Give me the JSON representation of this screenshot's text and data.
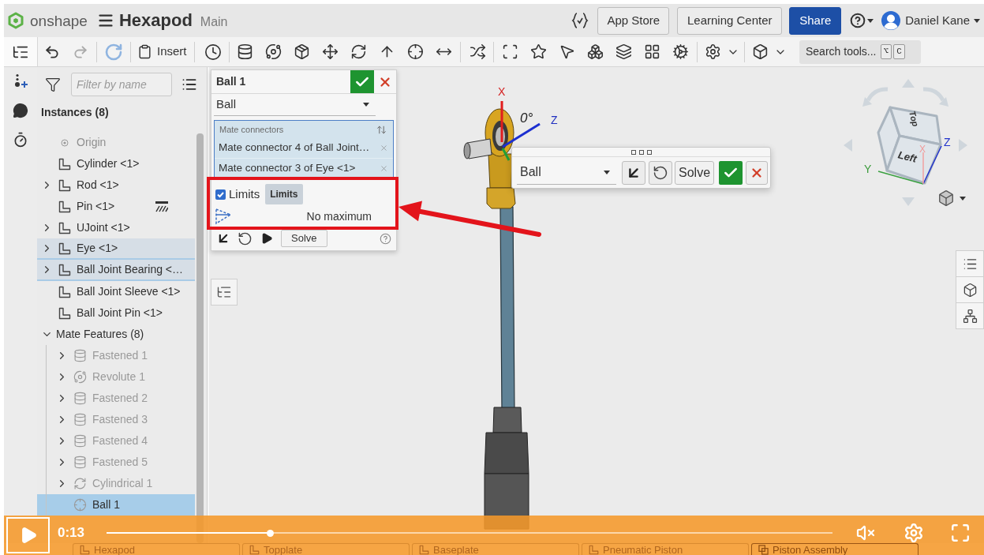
{
  "header": {
    "logo": "onshape",
    "document": "Hexapod",
    "workspace": "Main",
    "buttons": [
      {
        "label": "App Store",
        "kind": "default"
      },
      {
        "label": "Learning Center",
        "kind": "default"
      },
      {
        "label": "Share",
        "kind": "primary"
      }
    ],
    "user": "Daniel Kane"
  },
  "toolbar": {
    "undo": {
      "disabled": false
    },
    "redo": {
      "disabled": true
    },
    "insert": "Insert",
    "search": {
      "placeholder": "Search tools...",
      "keys": [
        "⌥",
        "C"
      ]
    }
  },
  "instances": {
    "filter": {
      "placeholder": "Filter by name"
    },
    "title": "Instances (8)",
    "items": [
      {
        "label": "Origin",
        "kind": "origin",
        "expandable": false,
        "highlighted": false,
        "dimmed": true,
        "has_marker": false
      },
      {
        "label": "Cylinder <1>",
        "kind": "part",
        "expandable": false,
        "highlighted": false,
        "dimmed": false,
        "has_marker": false
      },
      {
        "label": "Rod <1>",
        "kind": "part",
        "expandable": true,
        "highlighted": false,
        "dimmed": false,
        "has_marker": false
      },
      {
        "label": "Pin <1>",
        "kind": "part",
        "expandable": false,
        "highlighted": false,
        "dimmed": false,
        "has_marker": true
      },
      {
        "label": "UJoint <1>",
        "kind": "part",
        "expandable": true,
        "highlighted": false,
        "dimmed": false,
        "has_marker": false
      },
      {
        "label": "Eye <1>",
        "kind": "part",
        "expandable": true,
        "highlighted": true,
        "dimmed": false,
        "has_marker": false
      },
      {
        "label": "Ball Joint Bearing <…",
        "kind": "part",
        "expandable": true,
        "highlighted": true,
        "dimmed": false,
        "has_marker": false
      },
      {
        "label": "Ball Joint Sleeve <1>",
        "kind": "part",
        "expandable": false,
        "highlighted": false,
        "dimmed": false,
        "has_marker": false
      },
      {
        "label": "Ball Joint Pin <1>",
        "kind": "part",
        "expandable": false,
        "highlighted": false,
        "dimmed": false,
        "has_marker": false
      }
    ]
  },
  "mate_features": {
    "title": "Mate Features (8)",
    "expanded": true,
    "children": [
      {
        "label": "Fastened 1",
        "kind": "fastened",
        "expandable": true,
        "selected": false,
        "dimmed": true
      },
      {
        "label": "Revolute 1",
        "kind": "revolute",
        "expandable": true,
        "selected": false,
        "dimmed": true
      },
      {
        "label": "Fastened 2",
        "kind": "fastened",
        "expandable": true,
        "selected": false,
        "dimmed": true
      },
      {
        "label": "Fastened 3",
        "kind": "fastened",
        "expandable": true,
        "selected": false,
        "dimmed": true
      },
      {
        "label": "Fastened 4",
        "kind": "fastened",
        "expandable": true,
        "selected": false,
        "dimmed": true
      },
      {
        "label": "Fastened 5",
        "kind": "fastened",
        "expandable": true,
        "selected": false,
        "dimmed": true
      },
      {
        "label": "Cylindrical 1",
        "kind": "cylindrical",
        "expandable": true,
        "selected": false,
        "dimmed": true
      },
      {
        "label": "Ball 1",
        "kind": "ball",
        "expandable": false,
        "selected": true,
        "dimmed": false
      }
    ]
  },
  "mate_dialog": {
    "title": "Ball 1",
    "type": "Ball",
    "connectors": {
      "label": "Mate connectors",
      "items": [
        "Mate connector 4 of Ball Joint…",
        "Mate connector 3 of Eye <1>"
      ]
    },
    "limits": {
      "checked": true,
      "label": "Limits",
      "tooltip": "Limits",
      "maximum": "No maximum"
    },
    "solve": "Solve"
  },
  "viewport": {
    "triad": {
      "x": "X",
      "angle": "0°",
      "z": "Z"
    },
    "mate_toolbar": {
      "type": "Ball",
      "solve": "Solve"
    },
    "view_cube": {
      "faces": [
        "Top",
        "Left"
      ],
      "axes": [
        "X",
        "Y",
        "Z"
      ]
    }
  },
  "document_tabs": [
    {
      "label": "Hexapod",
      "kind": "part_studio",
      "selected": false
    },
    {
      "label": "Topplate",
      "kind": "part_studio",
      "selected": false
    },
    {
      "label": "Baseplate",
      "kind": "part_studio",
      "selected": false
    },
    {
      "label": "Pneumatic Piston",
      "kind": "part_studio",
      "selected": false
    },
    {
      "label": "Piston Assembly",
      "kind": "assembly",
      "selected": true
    }
  ],
  "video": {
    "playing": false,
    "time": "0:13",
    "level": 0.225,
    "muted": true
  }
}
